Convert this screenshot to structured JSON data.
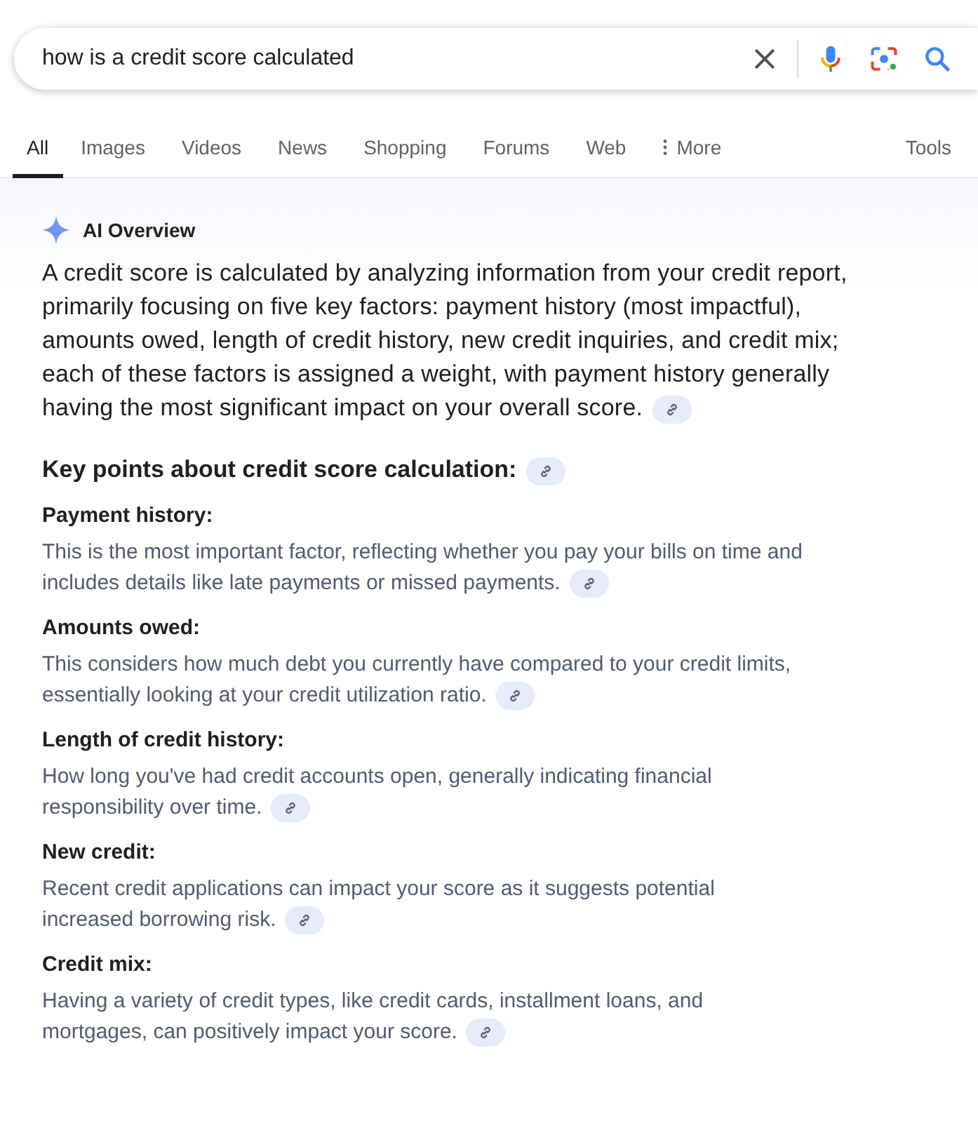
{
  "search": {
    "value": "how is a credit score calculated"
  },
  "tabs": [
    {
      "label": "All",
      "selected": true
    },
    {
      "label": "Images",
      "selected": false
    },
    {
      "label": "Videos",
      "selected": false
    },
    {
      "label": "News",
      "selected": false
    },
    {
      "label": "Shopping",
      "selected": false
    },
    {
      "label": "Forums",
      "selected": false
    },
    {
      "label": "Web",
      "selected": false
    },
    {
      "label": "More",
      "selected": false,
      "kind": "menu"
    }
  ],
  "tools": "Tools",
  "overview": {
    "title": "AI Overview",
    "summary": "A credit score is calculated by analyzing information from your credit report, primarily focusing on five key factors: payment history (most impactful), amounts owed, length of credit history, new credit inquiries, and credit mix; each of these factors is assigned a weight, with payment history generally having the most significant impact on your overall score.",
    "heading": "Key points about credit score calculation:",
    "points": [
      {
        "title": "Payment history:",
        "text": "This is the most important factor, reflecting whether you pay your bills on time and includes details like late payments or missed payments."
      },
      {
        "title": "Amounts owed:",
        "text": "This considers how much debt you currently have compared to your credit limits, essentially looking at your credit utilization ratio."
      },
      {
        "title": "Length of credit history:",
        "text": "How long you've had credit accounts open, generally indicating financial responsibility over time."
      },
      {
        "title": "New credit:",
        "text": "Recent credit applications can impact your score as it suggests potential increased borrowing risk."
      },
      {
        "title": "Credit mix:",
        "text": "Having a variety of credit types, like credit cards, installment loans, and mortgages, can positively impact your score."
      }
    ]
  }
}
